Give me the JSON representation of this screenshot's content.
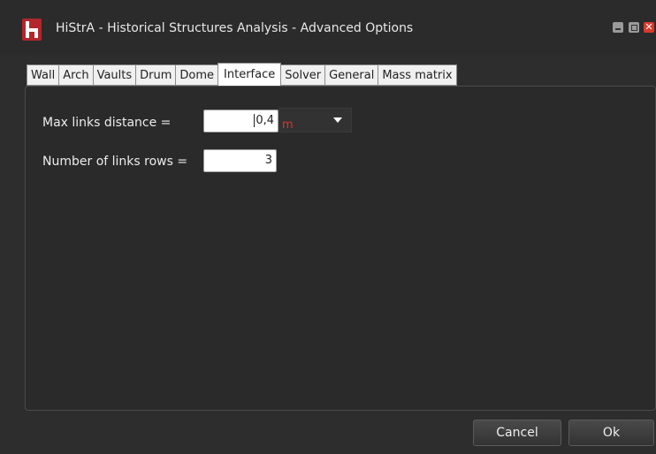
{
  "window": {
    "title": "HiStrA - Historical Structures Analysis - Advanced Options",
    "close_glyph": "✕"
  },
  "tabs": [
    {
      "label": "Wall",
      "active": false
    },
    {
      "label": "Arch",
      "active": false
    },
    {
      "label": "Vaults",
      "active": false
    },
    {
      "label": "Drum",
      "active": false
    },
    {
      "label": "Dome",
      "active": false
    },
    {
      "label": "Interface",
      "active": true
    },
    {
      "label": "Solver",
      "active": false
    },
    {
      "label": "General",
      "active": false
    },
    {
      "label": "Mass matrix",
      "active": false
    }
  ],
  "interface": {
    "max_links_label": "Max links distance =",
    "max_links_value": "0,4",
    "max_links_unit": "m",
    "rows_label": "Number of links rows =",
    "rows_value": "3"
  },
  "buttons": {
    "cancel": "Cancel",
    "ok": "Ok"
  },
  "colors": {
    "accent_logo": "#b3262b",
    "unit_text": "#e0312c",
    "close_button": "#d83a2c"
  }
}
